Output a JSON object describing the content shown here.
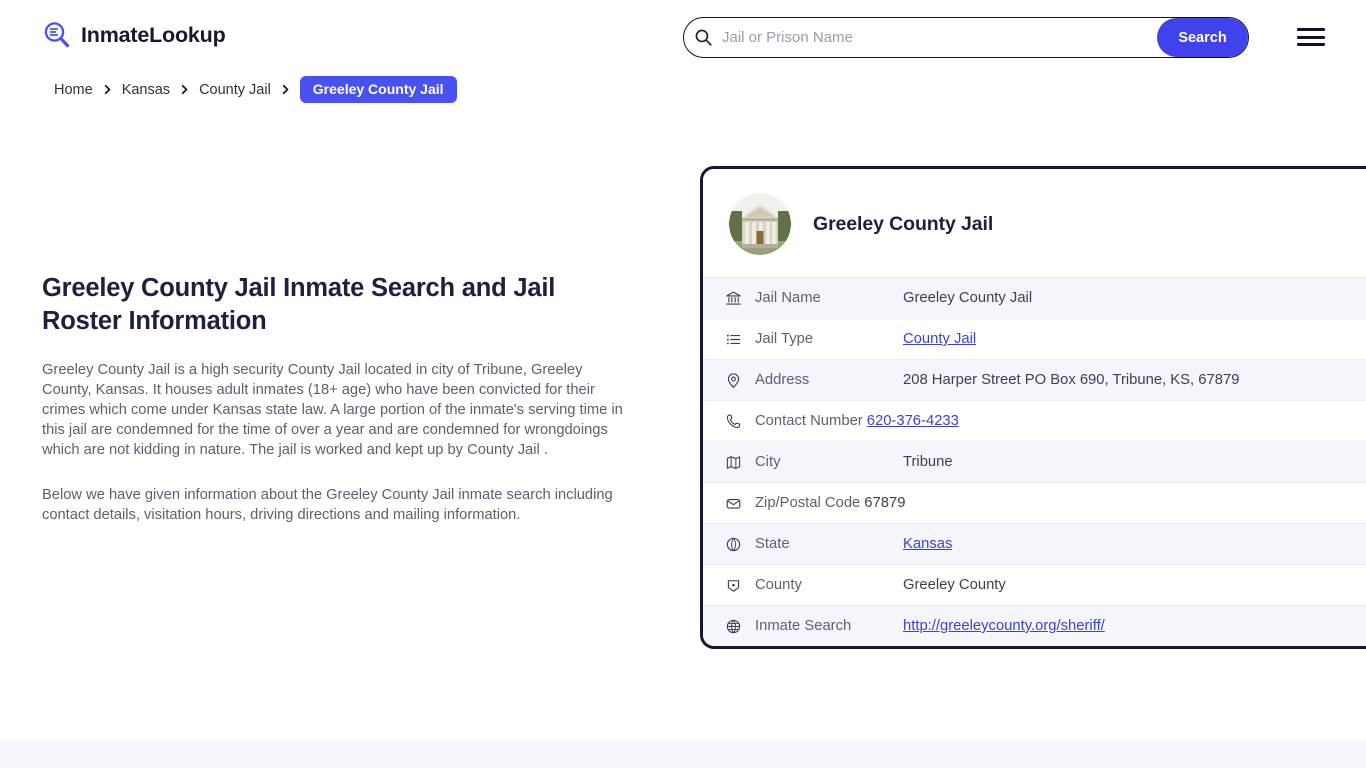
{
  "header": {
    "brand_name": "InmateLookup",
    "brand_icon": "search-list-logo-icon",
    "search": {
      "placeholder": "Jail or Prison Name",
      "value": "",
      "icon": "search-icon",
      "button_label": "Search"
    },
    "menu_icon": "hamburger-menu-icon"
  },
  "breadcrumb": {
    "items": [
      {
        "label": "Home",
        "current": false
      },
      {
        "label": "Kansas",
        "current": false
      },
      {
        "label": "County Jail",
        "current": false
      },
      {
        "label": "Greeley County Jail",
        "current": true
      }
    ],
    "separator_icon": "chevron-right-icon"
  },
  "main": {
    "title": "Greeley County Jail Inmate Search and Jail Roster Information",
    "paragraph_1": "Greeley County Jail is a high security County Jail located in city of Tribune, Greeley County, Kansas. It houses adult inmates (18+ age) who have been convicted for their crimes which come under Kansas state law. A large portion of the inmate's serving time in this jail are condemned for the time of over a year and are condemned for wrongdoings which are not kidding in nature. The jail is worked and kept up by County Jail .",
    "paragraph_2": "Below we have given information about the Greeley County Jail inmate search including contact details, visitation hours, driving directions and mailing information."
  },
  "info_card": {
    "photo_alt": "courthouse-building-photo",
    "title": "Greeley County Jail",
    "rows": [
      {
        "icon": "bank-icon",
        "label": "Jail Name",
        "value": "Greeley County Jail",
        "link": false
      },
      {
        "icon": "list-icon",
        "label": "Jail Type",
        "value": "County Jail",
        "link": true
      },
      {
        "icon": "map-pin-icon",
        "label": "Address",
        "value": "208 Harper Street PO Box 690, Tribune, KS, 67879",
        "link": false
      },
      {
        "icon": "phone-icon",
        "label": "Contact Number",
        "value": "620-376-4233",
        "link": true
      },
      {
        "icon": "map-icon",
        "label": "City",
        "value": "Tribune",
        "link": false
      },
      {
        "icon": "envelope-icon",
        "label": "Zip/Postal Code",
        "value": "67879",
        "link": false
      },
      {
        "icon": "globe-state-icon",
        "label": "State",
        "value": "Kansas",
        "link": true
      },
      {
        "icon": "county-icon",
        "label": "County",
        "value": "Greeley County",
        "link": false
      },
      {
        "icon": "globe-icon",
        "label": "Inmate Search",
        "value": "http://greeleycounty.org/sheriff/",
        "link": true
      }
    ]
  },
  "colors": {
    "accent_blue": "#4043ec",
    "badge_blue": "#4a51f2",
    "card_border": "#121a33",
    "row_alt_bg": "#f5f6fc",
    "link": "#3b42d8",
    "footer_bg": "#f6f6fd"
  }
}
